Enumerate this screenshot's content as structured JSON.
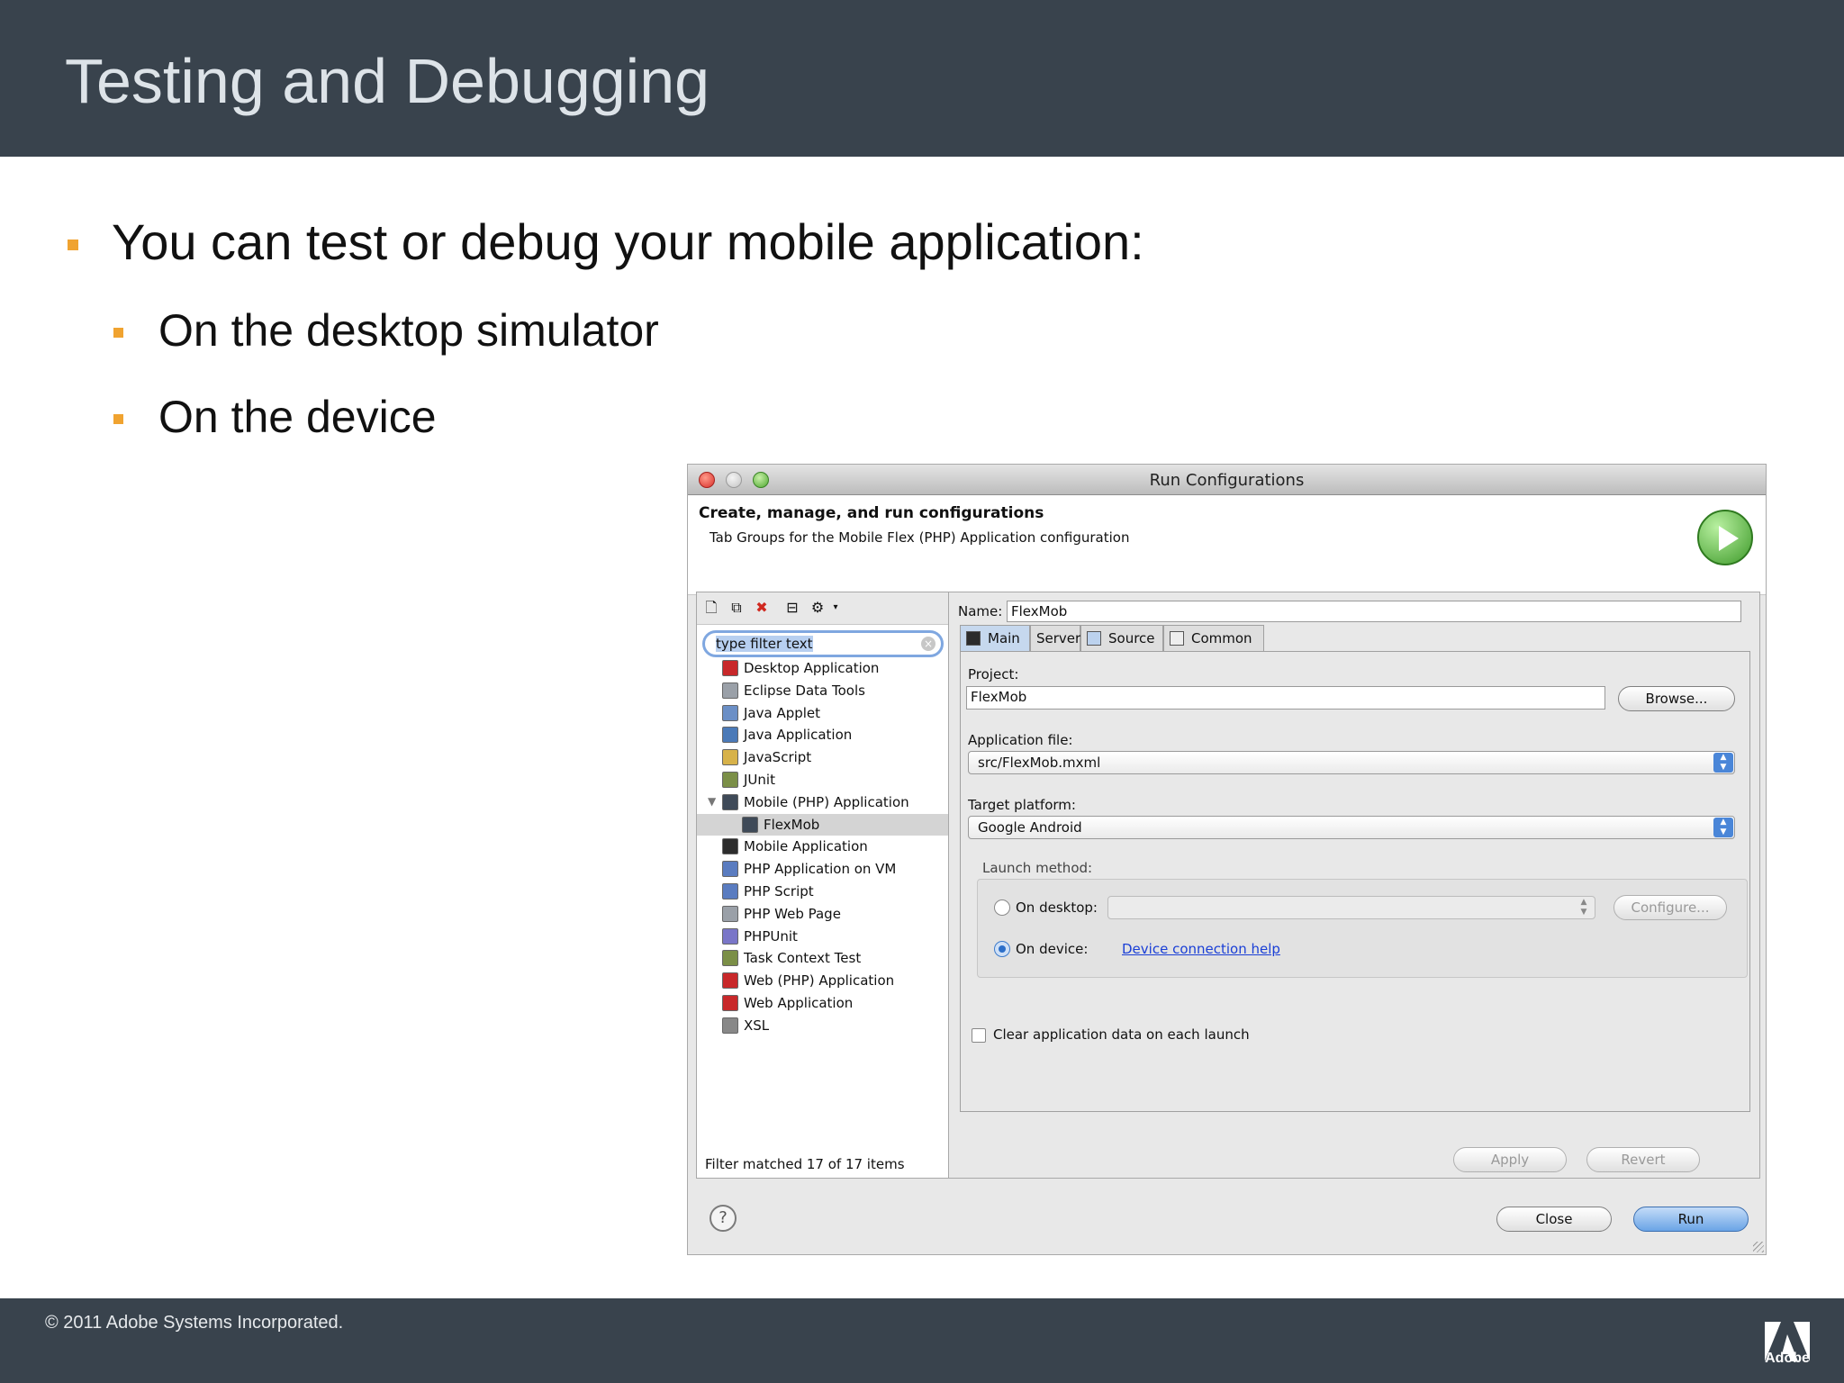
{
  "slide": {
    "title": "Testing and Debugging",
    "bullets": [
      "You can test or debug your mobile application:",
      "On the desktop simulator",
      "On the device"
    ],
    "footer": "© 2011 Adobe Systems Incorporated.",
    "logo_text": "Adobe",
    "colors": {
      "header_bg": "#39434d",
      "bullet": "#f0a330"
    }
  },
  "dialog": {
    "title": "Run Configurations",
    "banner_title": "Create, manage, and run configurations",
    "banner_subtitle": "Tab Groups for the Mobile Flex (PHP) Application configuration",
    "filter_placeholder": "type filter text",
    "tree": [
      {
        "label": "Desktop Application",
        "icon": "desktop-app-icon",
        "color": "#c8282a"
      },
      {
        "label": "Eclipse Data Tools",
        "icon": "database-icon",
        "color": "#9aa0a8"
      },
      {
        "label": "Java Applet",
        "icon": "java-applet-icon",
        "color": "#6b8fc6"
      },
      {
        "label": "Java Application",
        "icon": "java-app-icon",
        "color": "#4b7ab8"
      },
      {
        "label": "JavaScript",
        "icon": "javascript-icon",
        "color": "#d7b24a"
      },
      {
        "label": "JUnit",
        "icon": "junit-icon",
        "color": "#7b8f47"
      },
      {
        "label": "Mobile (PHP) Application",
        "icon": "mobile-php-icon",
        "color": "#3f4a58"
      },
      {
        "label": "FlexMob",
        "icon": "flexmob-icon",
        "color": "#3f4a58"
      },
      {
        "label": "Mobile Application",
        "icon": "mobile-app-icon",
        "color": "#2c2c2c"
      },
      {
        "label": "PHP Application on VM",
        "icon": "php-vm-icon",
        "color": "#5a7cc0"
      },
      {
        "label": "PHP Script",
        "icon": "php-script-icon",
        "color": "#5a7cc0"
      },
      {
        "label": "PHP Web Page",
        "icon": "php-web-page-icon",
        "color": "#9aa0a8"
      },
      {
        "label": "PHPUnit",
        "icon": "phpunit-icon",
        "color": "#7a76c8"
      },
      {
        "label": "Task Context Test",
        "icon": "task-context-icon",
        "color": "#7b8f47"
      },
      {
        "label": "Web (PHP) Application",
        "icon": "web-php-icon",
        "color": "#c8282a"
      },
      {
        "label": "Web Application",
        "icon": "web-app-icon",
        "color": "#c8282a"
      },
      {
        "label": "XSL",
        "icon": "xsl-icon",
        "color": "#888888"
      }
    ],
    "filter_status": "Filter matched 17 of 17 items",
    "name_label": "Name:",
    "name_value": "FlexMob",
    "tabs": [
      "Main",
      "Server",
      "Source",
      "Common"
    ],
    "project_label": "Project:",
    "project_value": "FlexMob",
    "browse_button": "Browse...",
    "app_file_label": "Application file:",
    "app_file_value": "src/FlexMob.mxml",
    "target_platform_label": "Target platform:",
    "target_platform_value": "Google Android",
    "launch_method_label": "Launch method:",
    "on_desktop_label": "On desktop:",
    "configure_button": "Configure...",
    "on_device_label": "On device:",
    "device_help_link": "Device connection help",
    "clear_data_label": "Clear application data on each launch",
    "apply_button": "Apply",
    "revert_button": "Revert",
    "close_button": "Close",
    "run_button": "Run",
    "help_icon": "?"
  }
}
